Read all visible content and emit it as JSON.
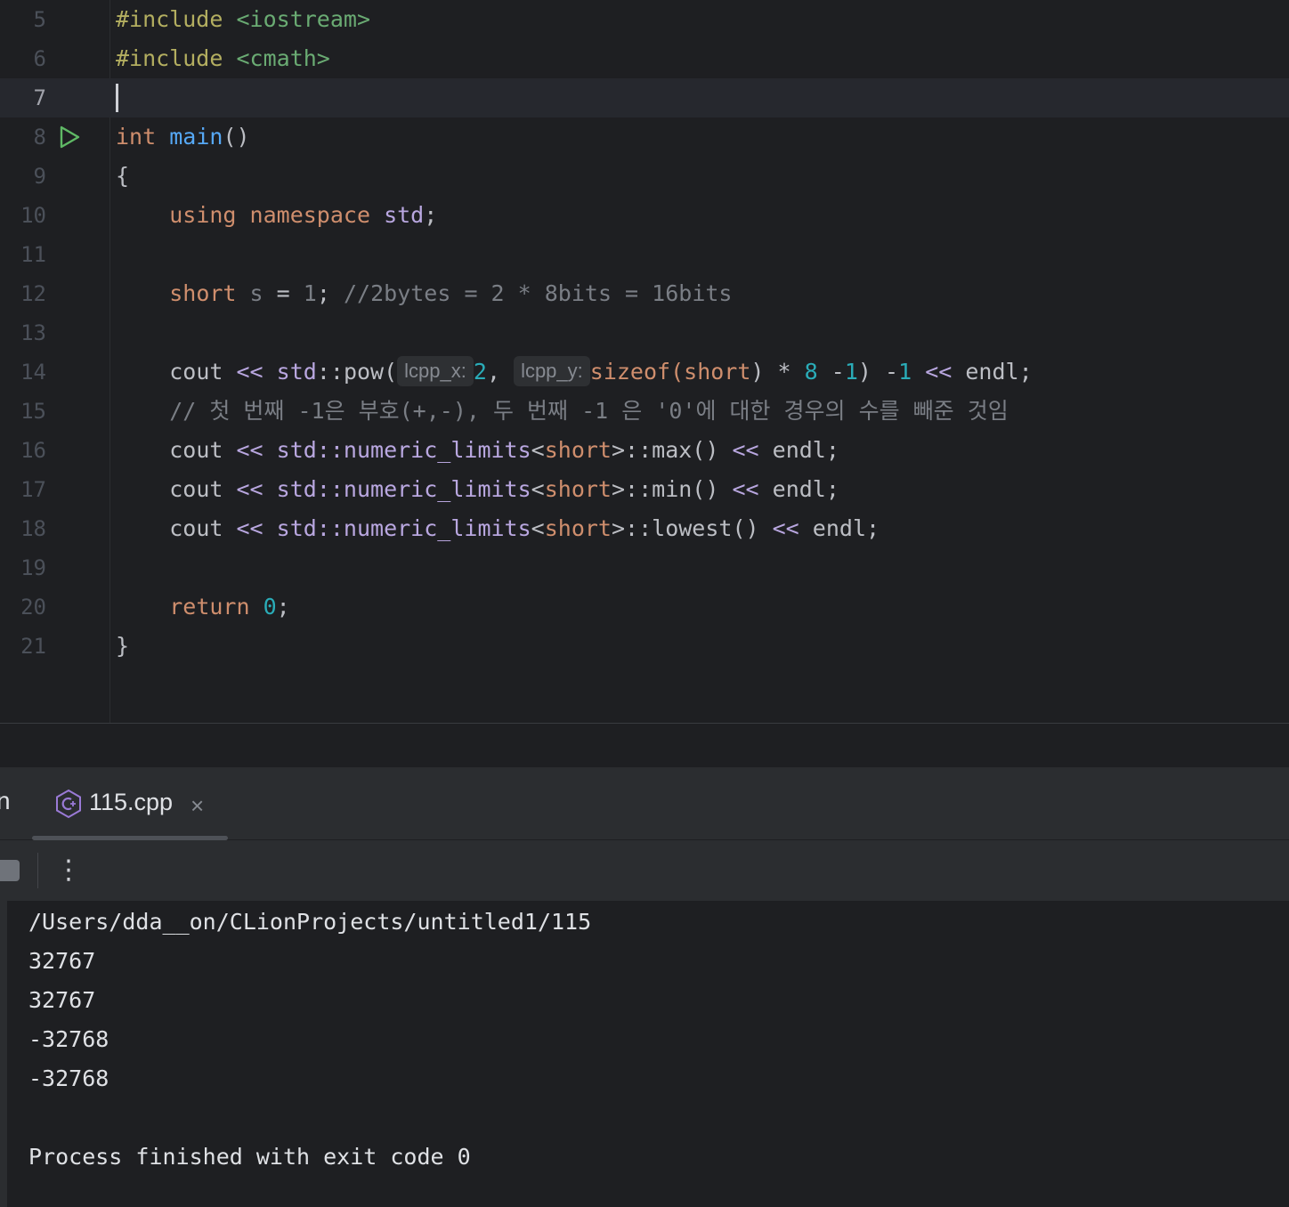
{
  "editor": {
    "lines": [
      {
        "number": "5"
      },
      {
        "number": "6"
      },
      {
        "number": "7"
      },
      {
        "number": "8"
      },
      {
        "number": "9"
      },
      {
        "number": "10"
      },
      {
        "number": "11"
      },
      {
        "number": "12"
      },
      {
        "number": "13"
      },
      {
        "number": "14"
      },
      {
        "number": "15"
      },
      {
        "number": "16"
      },
      {
        "number": "17"
      },
      {
        "number": "18"
      },
      {
        "number": "19"
      },
      {
        "number": "20"
      },
      {
        "number": "21"
      }
    ],
    "current_line": "7",
    "code": {
      "l5_directive": "#include",
      "l5_header": "<iostream>",
      "l6_directive": "#include",
      "l6_header": "<cmath>",
      "l8_type": "int",
      "l8_func": "main",
      "l8_parens": "()",
      "l9_brace": "{",
      "l10_using": "using",
      "l10_namespace": "namespace",
      "l10_std": "std",
      "l10_semi": ";",
      "l12_type": "short",
      "l12_var": "s",
      "l12_eq": "=",
      "l12_val": "1",
      "l12_semi": ";",
      "l12_comment": "//2bytes = 2 * 8bits = 16bits",
      "l14_cout": "cout",
      "l14_shift1": "<<",
      "l14_std": "std",
      "l14_scope": "::",
      "l14_pow": "pow(",
      "l14_hint_x": "lcpp_x:",
      "l14_two": "2",
      "l14_comma": ",",
      "l14_hint_y": "lcpp_y:",
      "l14_sizeof": "sizeof",
      "l14_open": "(",
      "l14_short": "short",
      "l14_close_mul": ") *",
      "l14_eight": "8",
      "l14_minus": "-",
      "l14_one": "1",
      "l14_close2": ")",
      "l14_minus2": "-",
      "l14_one2": "1",
      "l14_shift2": "<<",
      "l14_endl": "endl;",
      "l15_comment": "// 첫 번째 -1은 부호(+,-), 두 번째 -1 은 '0'에 대한 경우의 수를 빼준 것임",
      "l16_cout": "cout",
      "l16_shift1": "<<",
      "l16_nl": "std::numeric_limits",
      "l16_lt": "<",
      "l16_short": "short",
      "l16_rest": ">::max()",
      "l16_shift2": "<<",
      "l16_endl": "endl;",
      "l17_cout": "cout",
      "l17_shift1": "<<",
      "l17_nl": "std::numeric_limits",
      "l17_lt": "<",
      "l17_short": "short",
      "l17_rest": ">::min()",
      "l17_shift2": "<<",
      "l17_endl": "endl;",
      "l18_cout": "cout",
      "l18_shift1": "<<",
      "l18_nl": "std::numeric_limits",
      "l18_lt": "<",
      "l18_short": "short",
      "l18_rest": ">::lowest()",
      "l18_shift2": "<<",
      "l18_endl": "endl;",
      "l20_return": "return",
      "l20_zero": "0",
      "l20_semi": ";",
      "l21_brace": "}"
    }
  },
  "run_panel": {
    "tab_left_fragment": "n",
    "tab_label": "115.cpp",
    "tab_close": "×",
    "more_label": "⋮",
    "output": [
      "/Users/dda__on/CLionProjects/untitled1/115",
      "32767",
      "32767",
      "-32768",
      "-32768",
      "",
      "Process finished with exit code 0"
    ]
  },
  "icons": {
    "run": "run-gutter-icon",
    "file": "cpp-file-icon",
    "stop": "stop-icon",
    "more": "more-options-icon"
  },
  "colors": {
    "keyword": "#cf8e6d",
    "function": "#56a8f5",
    "number": "#2aacb8",
    "comment": "#7a7e85",
    "namespace": "#b9a7e0",
    "header": "#6aab73",
    "run_green": "#5fb865"
  }
}
